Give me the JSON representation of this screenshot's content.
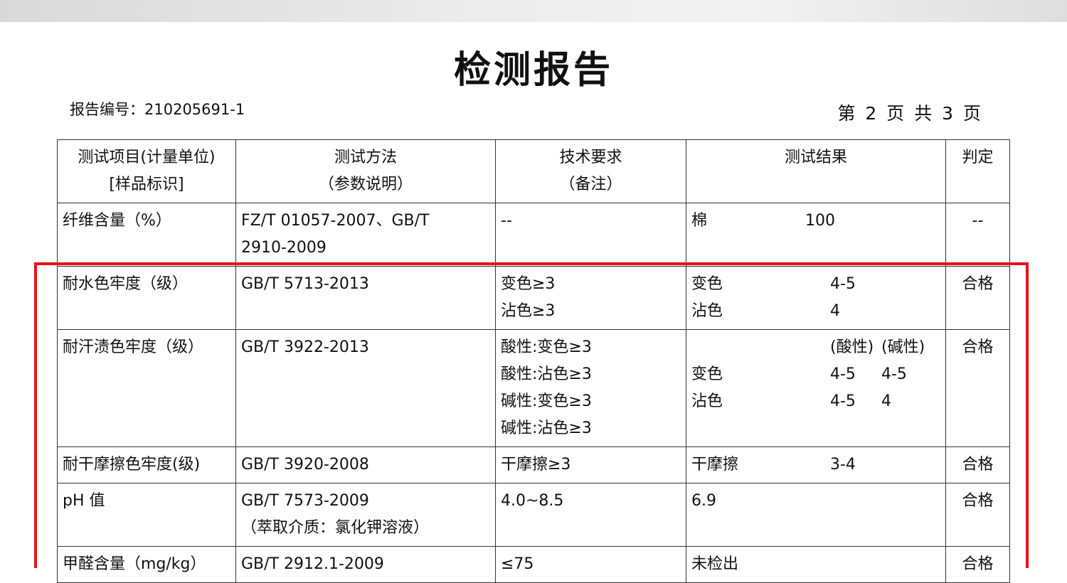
{
  "document": {
    "title": "检测报告",
    "report_no": "报告编号：210205691-1",
    "page_info": "第 2 页 共 3 页"
  },
  "table": {
    "headers": [
      {
        "line1": "测试项目(计量单位)",
        "line2": "[样品标识]"
      },
      {
        "line1": "测试方法",
        "line2": "（参数说明）"
      },
      {
        "line1": "技术要求",
        "line2": "（备注）"
      },
      {
        "line1": "测试结果",
        "line2": ""
      },
      {
        "line1": "判定",
        "line2": ""
      }
    ],
    "rows": [
      {
        "item": "纤维含量（%）",
        "method": [
          "FZ/T 01057-2007、GB/T",
          "2910-2009"
        ],
        "requirement": [
          "--"
        ],
        "result": [
          {
            "label": "棉",
            "v1": "100",
            "v2": ""
          }
        ],
        "verdict": "--"
      },
      {
        "item": "耐水色牢度（级）",
        "method": [
          "GB/T 5713-2013"
        ],
        "requirement": [
          "变色≥3",
          "沾色≥3"
        ],
        "result": [
          {
            "label": "变色",
            "v1": "4-5",
            "v2": ""
          },
          {
            "label": "沾色",
            "v1": "4",
            "v2": ""
          }
        ],
        "verdict": "合格"
      },
      {
        "item": "耐汗渍色牢度（级）",
        "method": [
          "GB/T 3922-2013"
        ],
        "requirement": [
          "酸性:变色≥3",
          "酸性:沾色≥3",
          "碱性:变色≥3",
          "碱性:沾色≥3"
        ],
        "result": [
          {
            "label": "",
            "v1": "(酸性)",
            "v2": "(碱性)"
          },
          {
            "label": "变色",
            "v1": "4-5",
            "v2": "4-5"
          },
          {
            "label": "沾色",
            "v1": "4-5",
            "v2": "4"
          }
        ],
        "verdict": "合格"
      },
      {
        "item": "耐干摩擦色牢度(级)",
        "method": [
          "GB/T 3920-2008"
        ],
        "requirement": [
          "干摩擦≥3"
        ],
        "result": [
          {
            "label": "干摩擦",
            "v1": "3-4",
            "v2": ""
          }
        ],
        "verdict": "合格"
      },
      {
        "item": "pH 值",
        "method": [
          "GB/T 7573-2009",
          "（萃取介质：氯化钾溶液）"
        ],
        "requirement": [
          "4.0~8.5"
        ],
        "result": [
          {
            "label": "6.9",
            "v1": "",
            "v2": ""
          }
        ],
        "verdict": "合格"
      },
      {
        "item": "甲醛含量（mg/kg）",
        "method": [
          "GB/T 2912.1-2009"
        ],
        "requirement": [
          "≤75"
        ],
        "result": [
          {
            "label": "未检出",
            "v1": "",
            "v2": ""
          }
        ],
        "verdict": "合格"
      }
    ]
  },
  "highlight_color": "#e8101a"
}
